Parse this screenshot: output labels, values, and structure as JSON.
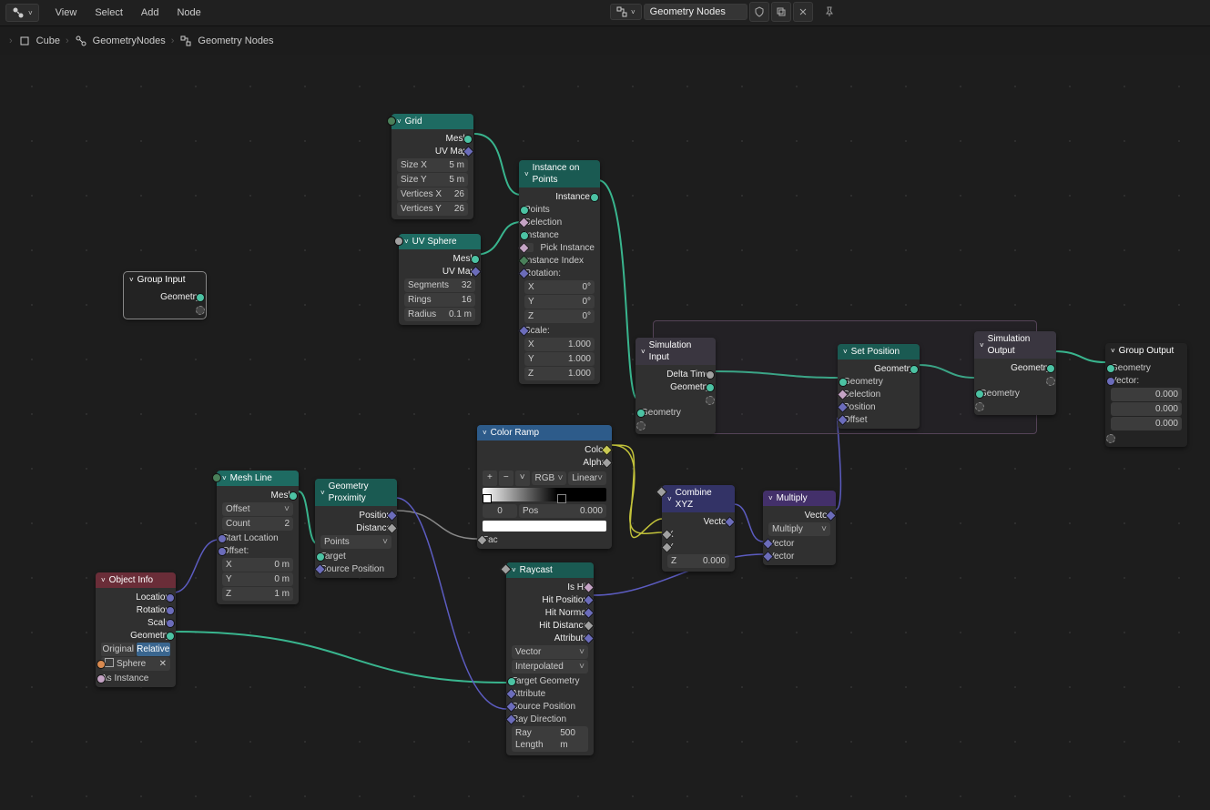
{
  "topbar": {
    "menus": [
      "View",
      "Select",
      "Add",
      "Node"
    ],
    "tree_name": "Geometry Nodes"
  },
  "breadcrumb": [
    "Cube",
    "GeometryNodes",
    "Geometry Nodes"
  ],
  "nodes": {
    "group_input": {
      "title": "Group Input",
      "out": [
        "Geometry"
      ]
    },
    "grid": {
      "title": "Grid",
      "out": [
        "Mesh",
        "UV Map"
      ],
      "fields": [
        [
          "Size X",
          "5 m"
        ],
        [
          "Size Y",
          "5 m"
        ],
        [
          "Vertices X",
          "26"
        ],
        [
          "Vertices Y",
          "26"
        ]
      ]
    },
    "uvsphere": {
      "title": "UV Sphere",
      "out": [
        "Mesh",
        "UV Map"
      ],
      "fields": [
        [
          "Segments",
          "32"
        ],
        [
          "Rings",
          "16"
        ],
        [
          "Radius",
          "0.1 m"
        ]
      ]
    },
    "inst": {
      "title": "Instance on Points",
      "out": [
        "Instances"
      ],
      "in": [
        "Points",
        "Selection",
        "Instance"
      ],
      "pick": "Pick Instance",
      "in2": "Instance Index",
      "rot": "Rotation:",
      "rotx": [
        "X",
        "0°"
      ],
      "roty": [
        "Y",
        "0°"
      ],
      "rotz": [
        "Z",
        "0°"
      ],
      "scale": "Scale:",
      "sx": [
        "X",
        "1.000"
      ],
      "sy": [
        "Y",
        "1.000"
      ],
      "sz": [
        "Z",
        "1.000"
      ]
    },
    "simin": {
      "title": "Simulation Input",
      "out": [
        "Delta Time",
        "Geometry"
      ],
      "in": [
        "Geometry"
      ]
    },
    "simout": {
      "title": "Simulation Output",
      "out": [
        "Geometry"
      ],
      "in": [
        "Geometry"
      ]
    },
    "setpos": {
      "title": "Set Position",
      "out": [
        "Geometry"
      ],
      "in": [
        "Geometry",
        "Selection",
        "Position",
        "Offset"
      ]
    },
    "groupout": {
      "title": "Group Output",
      "in": [
        "Geometry"
      ],
      "vec": "Vector:",
      "vals": [
        "0.000",
        "0.000",
        "0.000"
      ]
    },
    "objinfo": {
      "title": "Object Info",
      "out": [
        "Location",
        "Rotation",
        "Scale",
        "Geometry"
      ],
      "btn1": "Original",
      "btn2": "Relative",
      "obj": "Sphere",
      "as": "As Instance"
    },
    "meshline": {
      "title": "Mesh Line",
      "out": [
        "Mesh"
      ],
      "mode": "Offset",
      "count": [
        "Count",
        "2"
      ],
      "start": "Start Location",
      "off": "Offset:",
      "x": [
        "X",
        "0 m"
      ],
      "y": [
        "Y",
        "0 m"
      ],
      "z": [
        "Z",
        "1 m"
      ]
    },
    "prox": {
      "title": "Geometry Proximity",
      "out": [
        "Position",
        "Distance"
      ],
      "mode": "Points",
      "in": [
        "Target",
        "Source Position"
      ]
    },
    "ramp": {
      "title": "Color Ramp",
      "out": [
        "Color",
        "Alpha"
      ],
      "interp": "RGB",
      "mode": "Linear",
      "pos": [
        "Pos",
        "0.000"
      ],
      "stop": "0",
      "fac": "Fac"
    },
    "raycast": {
      "title": "Raycast",
      "out": [
        "Is Hit",
        "Hit Position",
        "Hit Normal",
        "Hit Distance",
        "Attribute"
      ],
      "sel1": "Vector",
      "sel2": "Interpolated",
      "in": [
        "Target Geometry",
        "Attribute",
        "Source Position",
        "Ray Direction"
      ],
      "rl": [
        "Ray Length",
        "500 m"
      ]
    },
    "combine": {
      "title": "Combine XYZ",
      "out": [
        "Vector"
      ],
      "x": "X",
      "y": "Y",
      "z": [
        "Z",
        "0.000"
      ]
    },
    "mult": {
      "title": "Multiply",
      "out": [
        "Vector"
      ],
      "mode": "Multiply",
      "in": [
        "Vector",
        "Vector"
      ]
    }
  }
}
